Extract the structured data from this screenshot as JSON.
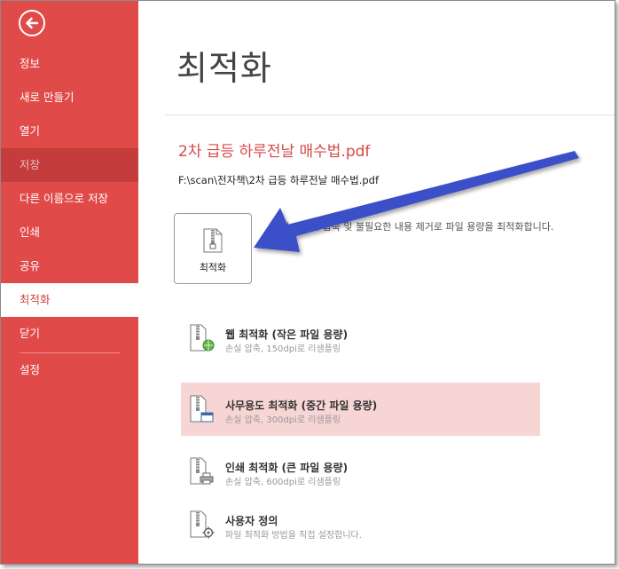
{
  "sidebar": {
    "items": [
      {
        "label": "정보",
        "state": "normal"
      },
      {
        "label": "새로 만들기",
        "state": "normal"
      },
      {
        "label": "열기",
        "state": "normal"
      },
      {
        "label": "저장",
        "state": "disabled"
      },
      {
        "label": "다른 이름으로 저장",
        "state": "normal"
      },
      {
        "label": "인쇄",
        "state": "normal"
      },
      {
        "label": "공유",
        "state": "normal"
      },
      {
        "label": "최적화",
        "state": "active"
      },
      {
        "label": "닫기",
        "state": "normal"
      },
      {
        "label": "설정",
        "state": "normal"
      }
    ]
  },
  "main": {
    "title": "최적화",
    "doc_name": "2차 급등 하루전날 매수법.pdf",
    "doc_path": "F:\\scan\\전자책\\2차 급등 하루전날 매수법.pdf",
    "optimize_button_label": "최적화",
    "description": "레벨 이미지 압축 및 불필요한 내용 제거로 파일 용량을 최적화합니다.",
    "options": [
      {
        "title": "웹 최적화 (작은 파일 용량)",
        "subtitle": "손실 압축, 150dpi로 리샘플링",
        "icon": "web-optimize-icon"
      },
      {
        "title": "사무용도 최적화 (중간 파일 용량)",
        "subtitle": "손실 압축, 300dpi로 리샘플링",
        "icon": "office-optimize-icon"
      },
      {
        "title": "인쇄 최적화 (큰 파일 용량)",
        "subtitle": "손실 압축, 600dpi로 리샘플링",
        "icon": "print-optimize-icon"
      },
      {
        "title": "사용자 정의",
        "subtitle": "파일 최적화 방법을 직접 설정합니다.",
        "icon": "custom-optimize-icon"
      }
    ]
  },
  "colors": {
    "sidebar_bg": "#e04a48",
    "accent_text": "#d64a48",
    "highlight_row": "#f7d5d5",
    "annotation_arrow": "#3b4fc8"
  }
}
